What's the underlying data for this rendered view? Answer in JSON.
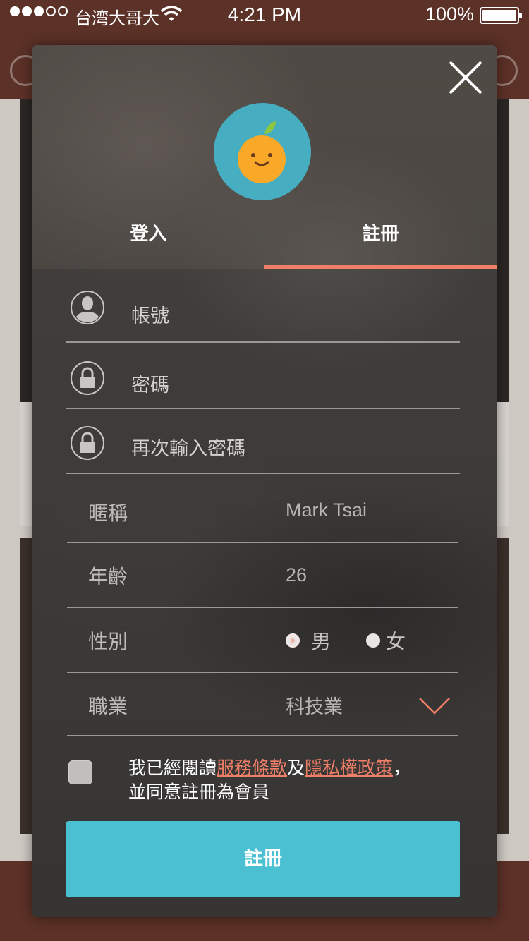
{
  "status_bar": {
    "carrier": "台湾大哥大",
    "time": "4:21 PM",
    "battery": "100%"
  },
  "tabs": [
    {
      "label": "登入"
    },
    {
      "label": "註冊"
    }
  ],
  "active_tab": "註冊",
  "fields": {
    "account_placeholder": "帳號",
    "password_placeholder": "密碼",
    "confirm_password_placeholder": "再次輸入密碼"
  },
  "profile": {
    "nickname": {
      "label": "暱稱",
      "value": "Mark Tsai"
    },
    "age": {
      "label": "年齡",
      "value": "26"
    },
    "gender": {
      "label": "性別",
      "options": [
        "男",
        "女"
      ],
      "selected": "男"
    },
    "occupation": {
      "label": "職業",
      "value": "科技業"
    }
  },
  "agreement": {
    "prefix": "我已經閱讀",
    "terms_link": "服務條款",
    "and": "及",
    "privacy_link": "隱私權政策",
    "suffix": "，",
    "line2": "並同意註冊為會員"
  },
  "submit_label": "註冊",
  "colors": {
    "accent": "#ef7f67",
    "button": "#4ac0d2",
    "logo_bg": "#46aec0",
    "header_brown": "#5c3127"
  },
  "icons": [
    "close-icon",
    "user-icon",
    "lock-icon",
    "chevron-down-icon",
    "orange-logo"
  ]
}
